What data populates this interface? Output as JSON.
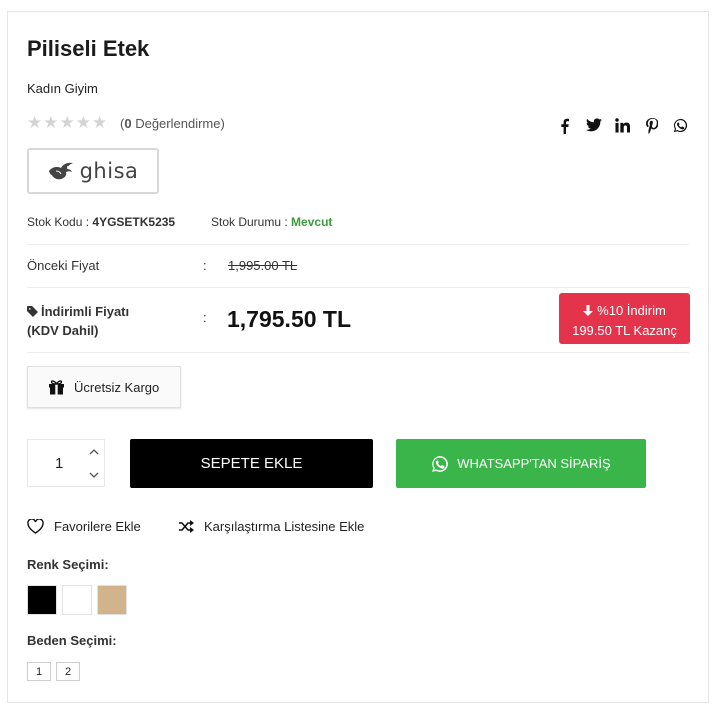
{
  "product": {
    "title": "Piliseli Etek",
    "category": "Kadın Giyim",
    "stars": "★★★★★",
    "review_count": "0",
    "review_label": "Değerlendirme",
    "brand_name": "ghisa"
  },
  "social": [
    "facebook-icon",
    "twitter-icon",
    "linkedin-icon",
    "pinterest-icon",
    "whatsapp-icon"
  ],
  "stock": {
    "code_label": "Stok Kodu :",
    "code_value": "4YGSETK5235",
    "status_label": "Stok Durumu :",
    "status_value": "Mevcut",
    "status_color": "#3a9b3a"
  },
  "pricing": {
    "previous_label": "Önceki Fiyat",
    "previous_price": "1,995.00 TL",
    "discount_label_line1": "İndirimli Fiyatı",
    "discount_label_line2": "(KDV Dahil)",
    "discount_price": "1,795.50 TL",
    "colon": ":",
    "badge_line1": "%10 İndirim",
    "badge_line2": "199.50 TL Kazanç",
    "badge_color": "#e4344b"
  },
  "shipping": {
    "label": "Ücretsiz Kargo"
  },
  "cart": {
    "quantity": "1",
    "add_label": "SEPETE EKLE",
    "whatsapp_label": "WHATSAPP'TAN SİPARİŞ",
    "whatsapp_color": "#3ab54a"
  },
  "actions": {
    "favorites": "Favorilere Ekle",
    "compare": "Karşılaştırma Listesine Ekle"
  },
  "colors": {
    "title": "Renk Seçimi:",
    "options": [
      "#000000",
      "#ffffff",
      "#d2b48c"
    ]
  },
  "sizes": {
    "title": "Beden Seçimi:",
    "options": [
      "1",
      "2"
    ]
  }
}
